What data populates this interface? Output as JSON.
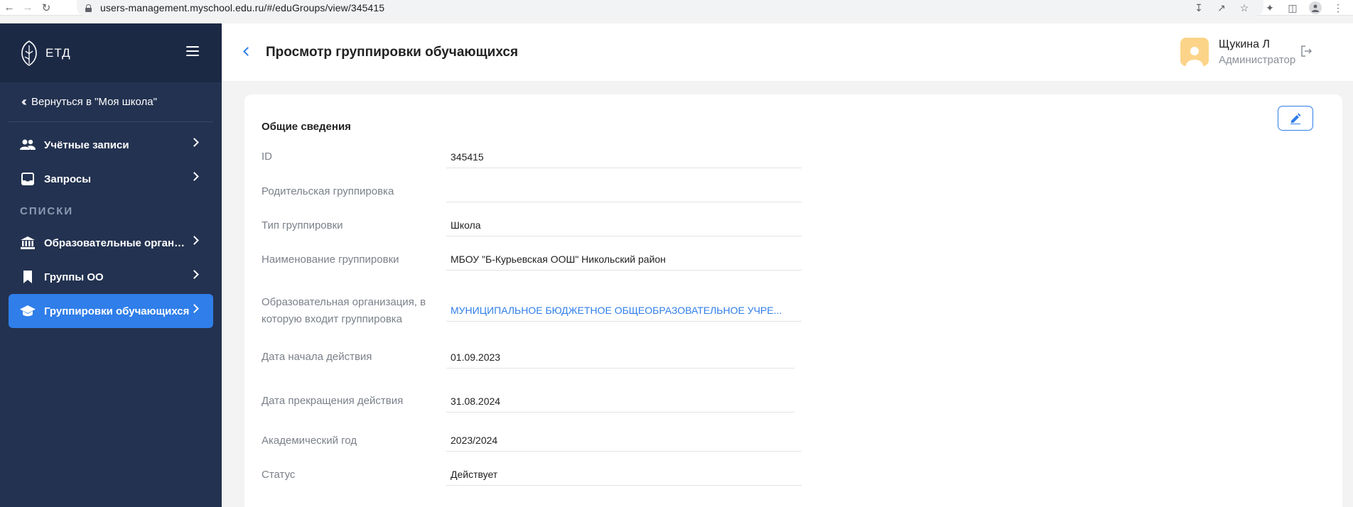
{
  "browser": {
    "url": "users-management.myschool.edu.ru/#/eduGroups/view/345415"
  },
  "sidebar": {
    "logo_text": "ЕТД",
    "back_label": "Вернуться в \"Моя школа\"",
    "items": [
      {
        "label": "Учётные записи",
        "icon": "users-icon"
      },
      {
        "label": "Запросы",
        "icon": "inbox-icon"
      }
    ],
    "section_label": "СПИСКИ",
    "list_items": [
      {
        "label": "Образовательные организа...",
        "icon": "institution-icon"
      },
      {
        "label": "Группы ОО",
        "icon": "bookmark-icon"
      },
      {
        "label": "Группировки обучающихся",
        "icon": "graduation-cap-icon",
        "active": true
      }
    ]
  },
  "header": {
    "title": "Просмотр группировки обучающихся",
    "user_name": "Щукина Л",
    "user_role": "Администратор"
  },
  "card": {
    "title": "Общие сведения",
    "fields": [
      {
        "label": "ID",
        "value": "345415"
      },
      {
        "label": "Родительская группировка",
        "value": ""
      },
      {
        "label": "Тип группировки",
        "value": "Школа"
      },
      {
        "label": "Наименование группировки",
        "value": "МБОУ \"Б-Курьевская ООШ\" Никольский район"
      },
      {
        "label": "Образовательная организация, в которую входит группировка",
        "value": "МУНИЦИПАЛЬНОЕ БЮДЖЕТНОЕ ОБЩЕОБРАЗОВАТЕЛЬНОЕ УЧРЕ..."
      },
      {
        "label": "Дата начала действия",
        "value": "01.09.2023"
      },
      {
        "label": "Дата прекращения действия",
        "value": "31.08.2024"
      },
      {
        "label": "Академический год",
        "value": "2023/2024"
      },
      {
        "label": "Статус",
        "value": "Действует"
      }
    ]
  },
  "colors": {
    "sidebar_bg": "#233250",
    "accent": "#2f7ee9",
    "avatar_bg": "#fcd489"
  }
}
